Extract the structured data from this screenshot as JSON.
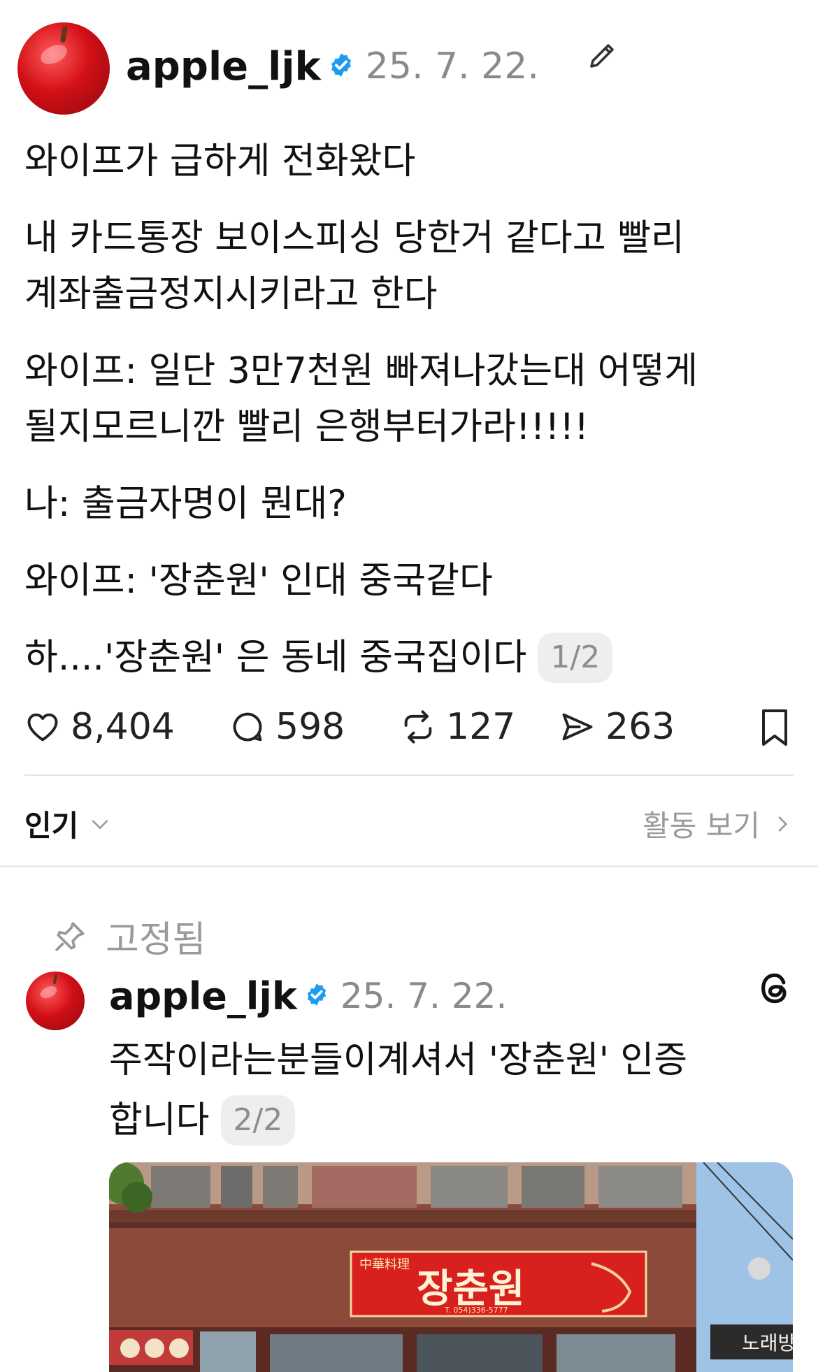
{
  "post": {
    "username": "apple_ljk",
    "date": "25. 7. 22.",
    "paragraphs": [
      "와이프가 급하게 전화왔다",
      "내 카드통장 보이스피싱 당한거 같다고 빨리",
      "계좌출금정지시키라고 한다",
      "와이프: 일단 3만7천원 빠져나갔는대 어떻게",
      "될지모르니깐 빨리 은행부터가라!!!!!",
      "나: 출금자명이 뭔대?",
      "와이프: '장춘원' 인대 중국같다",
      "하....'장춘원' 은 동네 중국집이다"
    ],
    "page_indicator": "1/2",
    "likes": "8,404",
    "comments": "598",
    "reposts": "127",
    "shares": "263"
  },
  "sort": {
    "label": "인기",
    "activity_label": "활동 보기"
  },
  "pinned": {
    "label": "고정됨",
    "username": "apple_ljk",
    "date": "25. 7. 22.",
    "text_line1": "주작이라는분들이계셔서 '장춘원' 인증",
    "text_line2": "합니다",
    "page_indicator": "2/2",
    "sign": {
      "hanja": "中華料理",
      "name": "장춘원",
      "phone": "T. 054)336-5777",
      "side_sign": "노래방"
    }
  },
  "colors": {
    "verified": "#1d9bf0",
    "muted": "#8a8a8a",
    "sign_red": "#d8201e"
  },
  "icons": [
    "apple-avatar",
    "verified-badge-icon",
    "edit-pencil-icon",
    "heart-icon",
    "comment-icon",
    "repost-icon",
    "share-icon",
    "bookmark-icon",
    "chevron-down-icon",
    "chevron-right-icon",
    "pin-icon",
    "threads-logo-icon"
  ]
}
